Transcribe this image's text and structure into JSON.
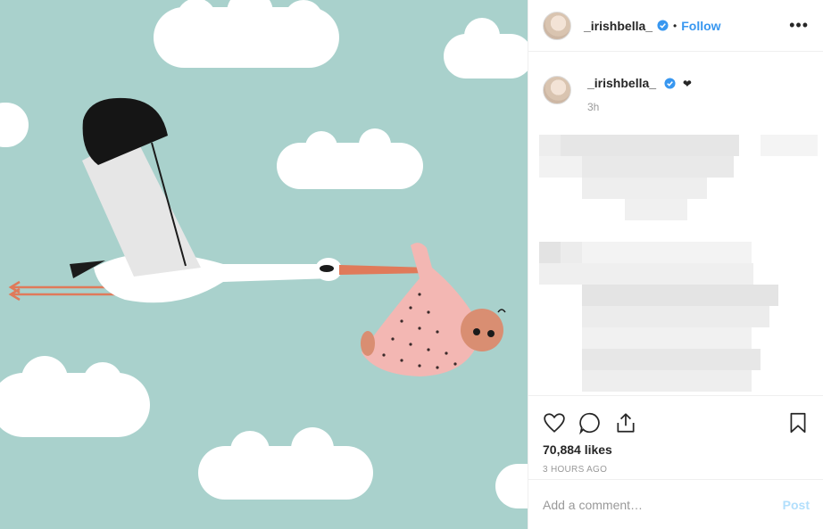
{
  "post": {
    "username": "_irishbella_",
    "follow_label": "Follow",
    "separator": "•",
    "more_label": "•••"
  },
  "caption": {
    "username": "_irishbella_",
    "emoji": "❤",
    "time": "3h"
  },
  "actions": {
    "likes": "70,884 likes",
    "timestamp": "3 HOURS AGO"
  },
  "comment": {
    "placeholder": "Add a comment…",
    "post_label": "Post"
  },
  "colors": {
    "sky": "#a9d1cc",
    "accent_blue": "#3897f0",
    "post_disabled": "#b2dffc"
  },
  "image": {
    "subject": "illustration of a stork carrying a baby in a pink bundle"
  }
}
